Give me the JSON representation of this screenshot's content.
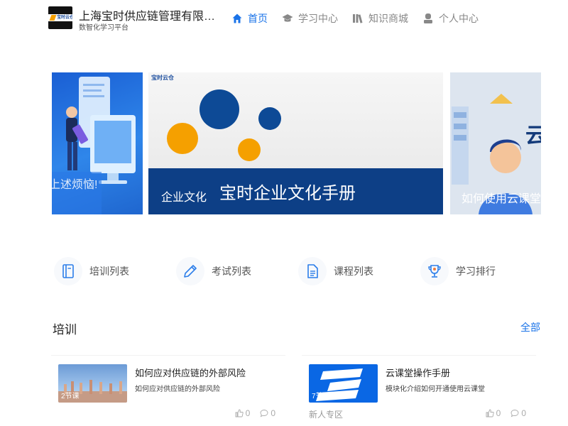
{
  "header": {
    "logo_text": "宝时云仓",
    "company": "上海宝时供应链管理有限公司",
    "subtitle": "数智化学习平台"
  },
  "nav": {
    "items": [
      {
        "label": "首页",
        "icon": "home-icon",
        "active": true
      },
      {
        "label": "学习中心",
        "icon": "graduation-cap-icon",
        "active": false
      },
      {
        "label": "知识商城",
        "icon": "books-icon",
        "active": false
      },
      {
        "label": "个人中心",
        "icon": "user-icon",
        "active": false
      }
    ]
  },
  "banner": {
    "left": {
      "text": "上述烦恼!"
    },
    "center": {
      "brand": "宝时云仓",
      "tag": "企业文化",
      "title": "宝时企业文化手册"
    },
    "right": {
      "text": "如何使用云课堂",
      "big_glyph": "云"
    }
  },
  "quick_menu": [
    {
      "label": "培训列表",
      "icon": "notebook-icon"
    },
    {
      "label": "考试列表",
      "icon": "pencil-icon"
    },
    {
      "label": "课程列表",
      "icon": "document-icon"
    },
    {
      "label": "学习排行",
      "icon": "trophy-icon"
    }
  ],
  "section": {
    "title": "培训",
    "more": "全部"
  },
  "cards": [
    {
      "title": "如何应对供应链的外部风险",
      "desc": "如何应对供应链的外部风险",
      "count": "2节课",
      "tag": "",
      "likes": "0",
      "comments": "0"
    },
    {
      "title": "云课堂操作手册",
      "desc": "模块化介绍如何开通使用云课堂",
      "count": "7节课",
      "tag": "新人专区",
      "likes": "0",
      "comments": "0"
    }
  ],
  "colors": {
    "accent": "#1a73e8",
    "banner_navy": "#0d3f86",
    "orange": "#f5a000"
  }
}
